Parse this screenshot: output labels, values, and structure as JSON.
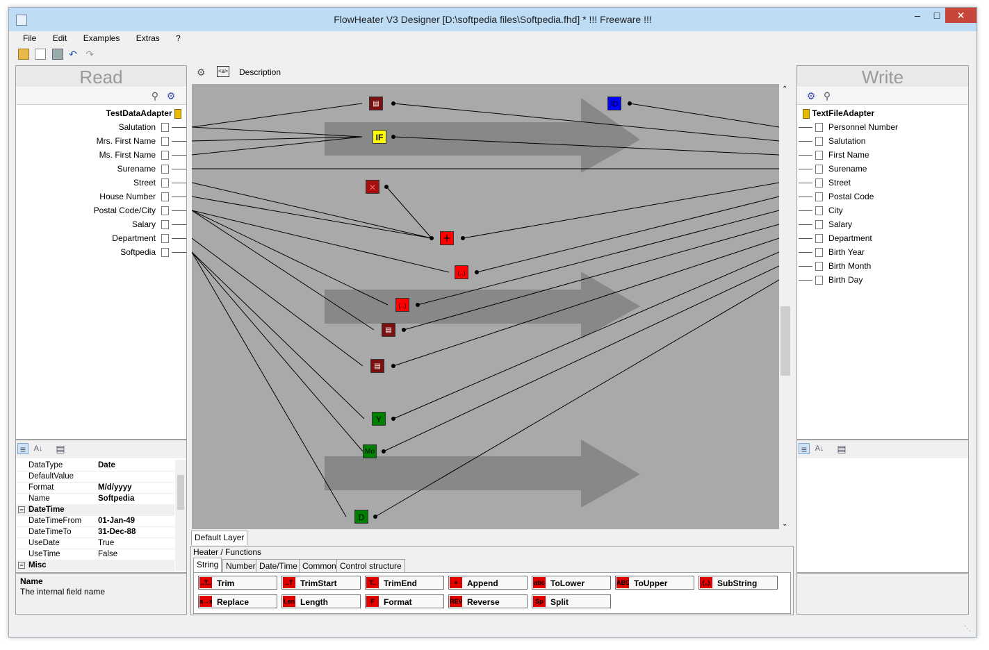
{
  "window": {
    "title": "FlowHeater V3 Designer [D:\\softpedia files\\Softpedia.fhd] * !!! Freeware !!!"
  },
  "menu": [
    "File",
    "Edit",
    "Examples",
    "Extras",
    "?"
  ],
  "canvas_toolbar": {
    "description_label": "Description"
  },
  "read": {
    "title": "Read",
    "adapter": "TestDataAdapter",
    "fields": [
      "Salutation",
      "Mrs. First Name",
      "Ms. First Name",
      "Surename",
      "Street",
      "House Number",
      "Postal Code/City",
      "Salary",
      "Department",
      "Softpedia"
    ]
  },
  "write": {
    "title": "Write",
    "adapter": "TextFileAdapter",
    "fields": [
      "Personnel Number",
      "Salutation",
      "First Name",
      "Surename",
      "Street",
      "Postal Code",
      "City",
      "Salary",
      "Department",
      "Birth Year",
      "Birth Month",
      "Birth Day"
    ]
  },
  "properties": {
    "rows": [
      {
        "key": "DataType",
        "value": "Date",
        "bold": true
      },
      {
        "key": "DefaultValue",
        "value": ""
      },
      {
        "key": "Format",
        "value": "M/d/yyyy",
        "bold": true
      },
      {
        "key": "Name",
        "value": "Softpedia",
        "bold": true
      },
      {
        "category": "DateTime"
      },
      {
        "key": "DateTimeFrom",
        "value": "01-Jan-49",
        "bold": true
      },
      {
        "key": "DateTimeTo",
        "value": "31-Dec-88",
        "bold": true
      },
      {
        "key": "UseDate",
        "value": "True"
      },
      {
        "key": "UseTime",
        "value": "False"
      },
      {
        "category": "Misc"
      }
    ],
    "description_title": "Name",
    "description_text": "The internal field name"
  },
  "nodes": {
    "if": "IF",
    "id": "ID",
    "substring1": "(..)",
    "substring2": "(..)",
    "year": "Y",
    "month": "Mo",
    "day": "D"
  },
  "layer_tab": "Default Layer",
  "heater": {
    "title": "Heater / Functions",
    "tabs": [
      "String",
      "Number",
      "Date/Time",
      "Common",
      "Control structure"
    ],
    "buttons": [
      {
        "label": "Trim",
        "icon": "..T.."
      },
      {
        "label": "TrimStart",
        "icon": "..T"
      },
      {
        "label": "TrimEnd",
        "icon": "T.."
      },
      {
        "label": "Append",
        "icon": "+"
      },
      {
        "label": "ToLower",
        "icon": "abc"
      },
      {
        "label": "ToUpper",
        "icon": "ABC"
      },
      {
        "label": "SubString",
        "icon": "(..)"
      },
      {
        "label": "Replace",
        "icon": "a→x"
      },
      {
        "label": "Length",
        "icon": "Len"
      },
      {
        "label": "Format",
        "icon": "F"
      },
      {
        "label": "Reverse",
        "icon": "REV"
      },
      {
        "label": "Split",
        "icon": "Sp"
      }
    ]
  },
  "colors": {
    "canvas": "#a9a9a9",
    "node_dark_red": "#7b1010",
    "node_red": "#ff0000",
    "node_yellow": "#ffff00",
    "node_blue": "#0000ff",
    "node_green": "#008000"
  }
}
